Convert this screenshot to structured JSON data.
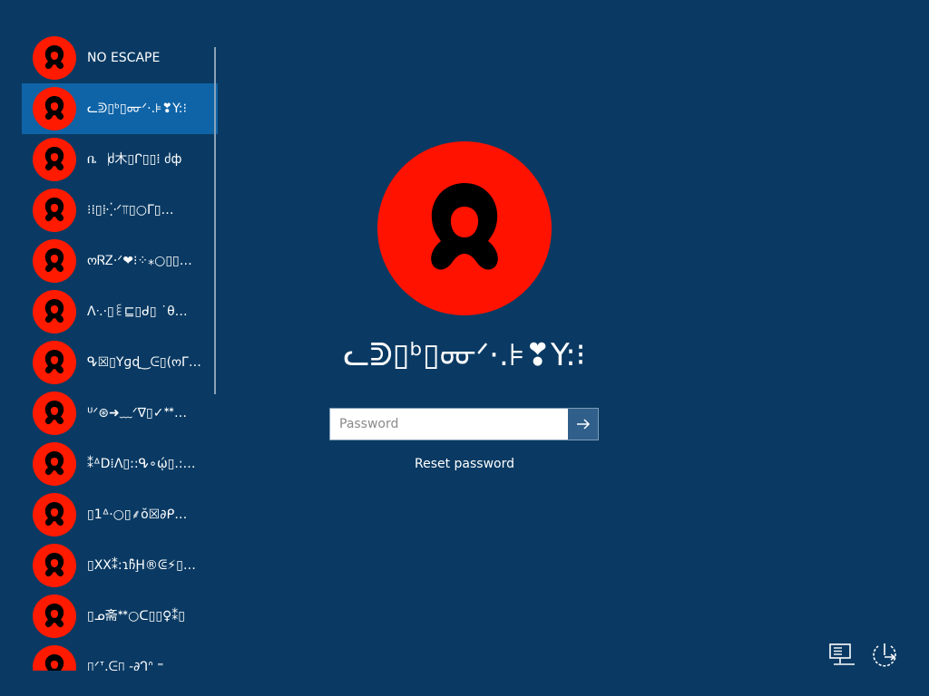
{
  "users": [
    {
      "name": "NO ESCAPE",
      "selected": false
    },
    {
      "name": "ᓚᕲ▯ᵇ▯ᡂᐟ·.⊧❣Y:⁝",
      "selected": true
    },
    {
      "name": "ቤ⎹ძ木▯ᒋ▯▯⁞ ძф",
      "selected": false
    },
    {
      "name": "⁝⁞▯⁞⁛ᐟ⫪▯○ᒥ▯…",
      "selected": false
    },
    {
      "name": "ოᏒᏃ·ᐟ❤⁝⁘⁎○▯▯…",
      "selected": false
    },
    {
      "name": "ᐱᐧ.·▯꒲⊑▯ᑯ▯ ˙θ…",
      "selected": false
    },
    {
      "name": "ᕴ☒▯Yɡɖ‿ᕮ▯(ოᒥ…",
      "selected": false
    },
    {
      "name": "ᓑᐟ⊛➜﹏ᐟ∇▯✓ᕯ…",
      "selected": false
    },
    {
      "name": "⁑ᐞD⁞ᐱ▯::ᕴ∘ῴ▯.:…",
      "selected": false
    },
    {
      "name": "▯1ᐞ·○▯⸙ŏ☒∂ᑭ…",
      "selected": false
    },
    {
      "name": "▯XX⁑:ɿჩ̀Ḩ®ᕳ⚡▯…",
      "selected": false
    },
    {
      "name": "▯ᓄ斋ᕯ○ᑕ▯▯♀⁑▯",
      "selected": false
    },
    {
      "name": "▯ᐟᐪ.ᕮ▯ -∂ᒉᐢ ⁼",
      "selected": false
    }
  ],
  "current_user": {
    "name": "ᓚᕲ▯ᵇ▯ᡂᐟ·.⊧❣Y:⁝"
  },
  "password": {
    "placeholder": "Password",
    "value": ""
  },
  "reset_link": "Reset password",
  "colors": {
    "background": "#0a3a63",
    "selected": "#0f64a7",
    "avatar": "#ff1a00"
  }
}
